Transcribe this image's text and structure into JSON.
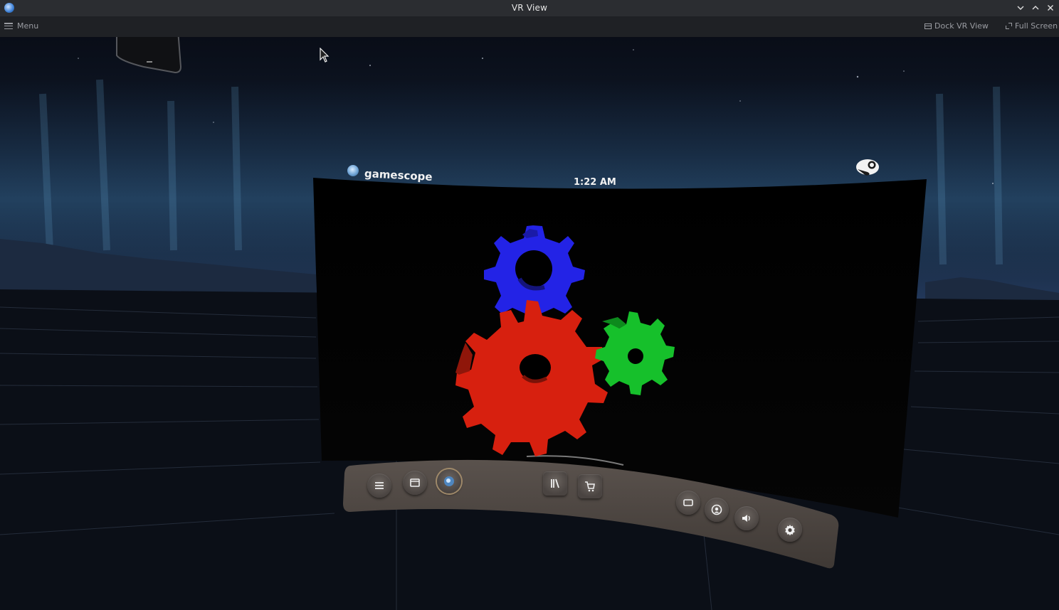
{
  "window": {
    "title": "VR View",
    "controls": [
      "minimize",
      "maximize",
      "close"
    ]
  },
  "menubar": {
    "menu_label": "Menu",
    "dock_label": "Dock VR View",
    "fullscreen_label": "Full Screen"
  },
  "vr_scene": {
    "app_name": "gamescope",
    "clock": "1:22 AM",
    "dashboard_buttons": [
      "menu-icon",
      "window-icon",
      "gamescope-app-icon",
      "library-icon",
      "store-cart-icon",
      "desktop-display-icon",
      "friends-icon",
      "volume-icon",
      "settings-gear-icon"
    ]
  },
  "colors": {
    "gear_blue": "#2222e8",
    "gear_red": "#d41f0e",
    "gear_green": "#13c22a",
    "titlebar_bg": "#2b2d31",
    "menubar_bg": "#1f2125",
    "dashboard_bg": "#4e4743"
  }
}
